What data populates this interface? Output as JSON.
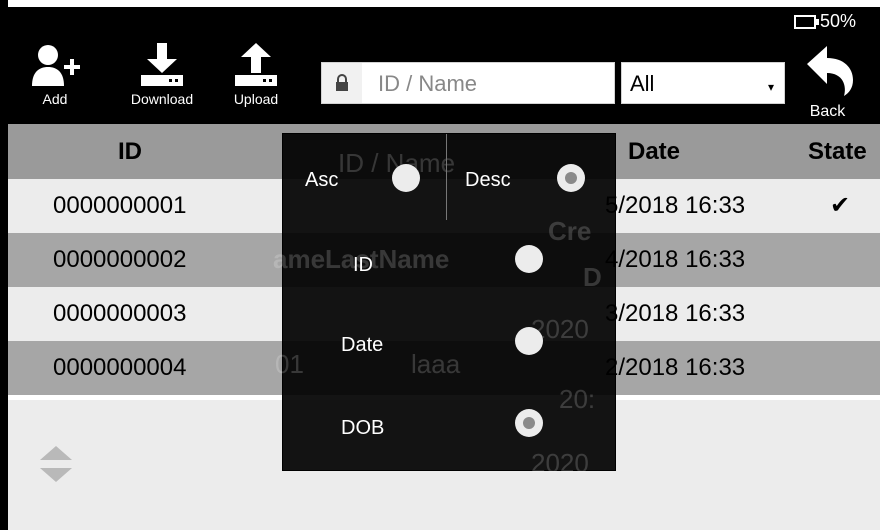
{
  "status": {
    "battery": "50%"
  },
  "toolbar": {
    "add_label": "Add",
    "download_label": "Download",
    "upload_label": "Upload",
    "search_placeholder": "ID / Name",
    "filter_selected": "All",
    "back_label": "Back"
  },
  "table": {
    "columns": [
      "ID",
      "Date",
      "State"
    ],
    "rows": [
      {
        "id": "0000000001",
        "date": "5/2018 16:33",
        "state": "✔"
      },
      {
        "id": "0000000002",
        "date": "4/2018 16:33",
        "state": ""
      },
      {
        "id": "0000000003",
        "date": "3/2018 16:33",
        "state": ""
      },
      {
        "id": "0000000004",
        "date": "2/2018 16:33",
        "state": ""
      }
    ]
  },
  "sort_popup": {
    "asc_label": "Asc",
    "desc_label": "Desc",
    "options": [
      "ID",
      "Date",
      "DOB"
    ],
    "selected_order": "Desc",
    "selected_field": "DOB",
    "ghost_texts": [
      "ID / Name",
      "ameLastName",
      "Cre",
      "D",
      "2020",
      "01",
      "laaa",
      "20:",
      "2020"
    ]
  }
}
